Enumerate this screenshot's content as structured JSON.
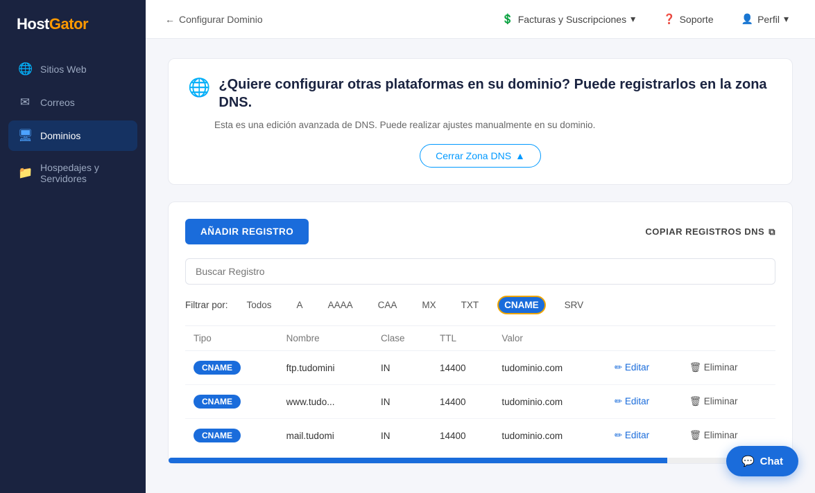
{
  "sidebar": {
    "logo": "HostGator",
    "items": [
      {
        "id": "sitios-web",
        "label": "Sitios Web",
        "icon": "🌐"
      },
      {
        "id": "correos",
        "label": "Correos",
        "icon": "✉"
      },
      {
        "id": "dominios",
        "label": "Dominios",
        "icon": "🖥",
        "active": true
      },
      {
        "id": "hospedajes",
        "label": "Hospedajes y Servidores",
        "icon": "📁"
      }
    ]
  },
  "topnav": {
    "back_label": "Configurar Dominio",
    "facturas_label": "Facturas y Suscripciones",
    "soporte_label": "Soporte",
    "perfil_label": "Perfil"
  },
  "dns_banner": {
    "icon": "🌐",
    "heading": "¿Quiere configurar otras plataformas en su dominio? Puede registrarlos en la zona DNS.",
    "subtitle": "Esta es una edición avanzada de DNS. Puede realizar ajustes manualmente en su dominio.",
    "close_btn": "Cerrar Zona DNS"
  },
  "dns_section": {
    "add_btn": "AÑADIR REGISTRO",
    "copy_btn": "COPIAR REGISTROS DNS",
    "search_placeholder": "Buscar Registro",
    "filter_label": "Filtrar por:",
    "filters": [
      {
        "id": "todos",
        "label": "Todos"
      },
      {
        "id": "a",
        "label": "A"
      },
      {
        "id": "aaaa",
        "label": "AAAA"
      },
      {
        "id": "caa",
        "label": "CAA"
      },
      {
        "id": "mx",
        "label": "MX"
      },
      {
        "id": "txt",
        "label": "TXT"
      },
      {
        "id": "cname",
        "label": "CNAME",
        "active": true
      },
      {
        "id": "srv",
        "label": "SRV"
      }
    ],
    "table": {
      "headers": [
        "Tipo",
        "Nombre",
        "Clase",
        "TTL",
        "Valor",
        "",
        ""
      ],
      "rows": [
        {
          "tipo": "CNAME",
          "nombre": "ftp.tudomini",
          "clase": "IN",
          "ttl": "14400",
          "valor": "tudominio.com"
        },
        {
          "tipo": "CNAME",
          "nombre": "www.tudo...",
          "clase": "IN",
          "ttl": "14400",
          "valor": "tudominio.com"
        },
        {
          "tipo": "CNAME",
          "nombre": "mail.tudomi",
          "clase": "IN",
          "ttl": "14400",
          "valor": "tudominio.com"
        }
      ],
      "edit_label": "Editar",
      "delete_label": "Eliminar"
    }
  },
  "chat": {
    "label": "Chat"
  }
}
